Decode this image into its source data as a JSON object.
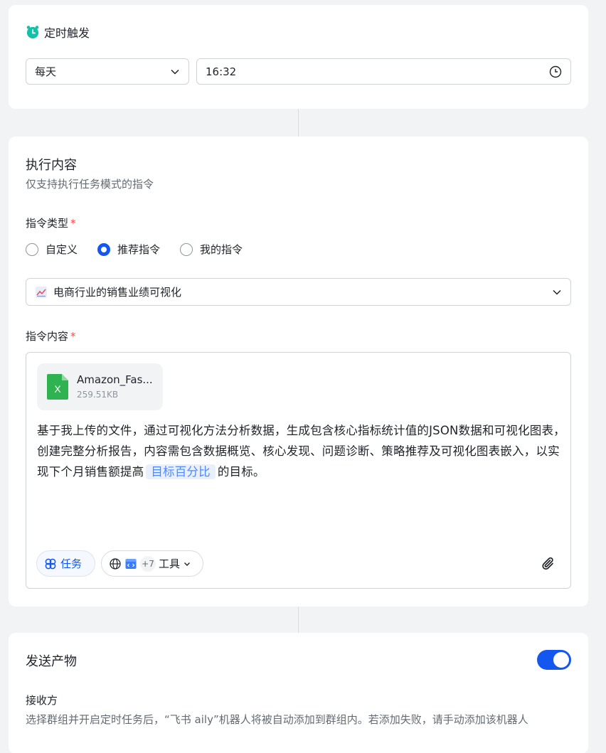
{
  "trigger": {
    "title": "定时触发",
    "frequency": "每天",
    "time": "16:32"
  },
  "content": {
    "title": "执行内容",
    "subtitle": "仅支持执行任务模式的指令",
    "command_type_label": "指令类型",
    "required_mark": "*",
    "radio_options": [
      {
        "label": "自定义",
        "checked": false
      },
      {
        "label": "推荐指令",
        "checked": true
      },
      {
        "label": "我的指令",
        "checked": false
      }
    ],
    "selected_command": "电商行业的销售业绩可视化",
    "command_content_label": "指令内容",
    "file": {
      "name": "Amazon_Fas...",
      "size": "259.51KB",
      "type_letter": "X"
    },
    "text_before": "基于我上传的文件，通过可视化方法分析数据，生成包含核心指标统计值的JSON数据和可视化图表，创建完整分析报告，内容需包含数据概览、核心发现、问题诊断、策略推荐及可视化图表嵌入，以实现下个月销售额提高",
    "variable": "目标百分比",
    "text_after": "的目标。",
    "task_label": "任务",
    "tools_count": "+7",
    "tools_label": "工具"
  },
  "send": {
    "title": "发送产物",
    "toggle_on": true,
    "receiver_label": "接收方",
    "note": "选择群组并开启定时任务后，“飞书 aily”机器人将被自动添加到群组内。若添加失败，请手动添加该机器人"
  },
  "colors": {
    "accent": "#1456f0",
    "alarm": "#14c0a8",
    "excel": "#2fb350",
    "required": "#f54a45",
    "variable_bg": "#e8f0ff",
    "variable_text": "#4c88ff"
  }
}
